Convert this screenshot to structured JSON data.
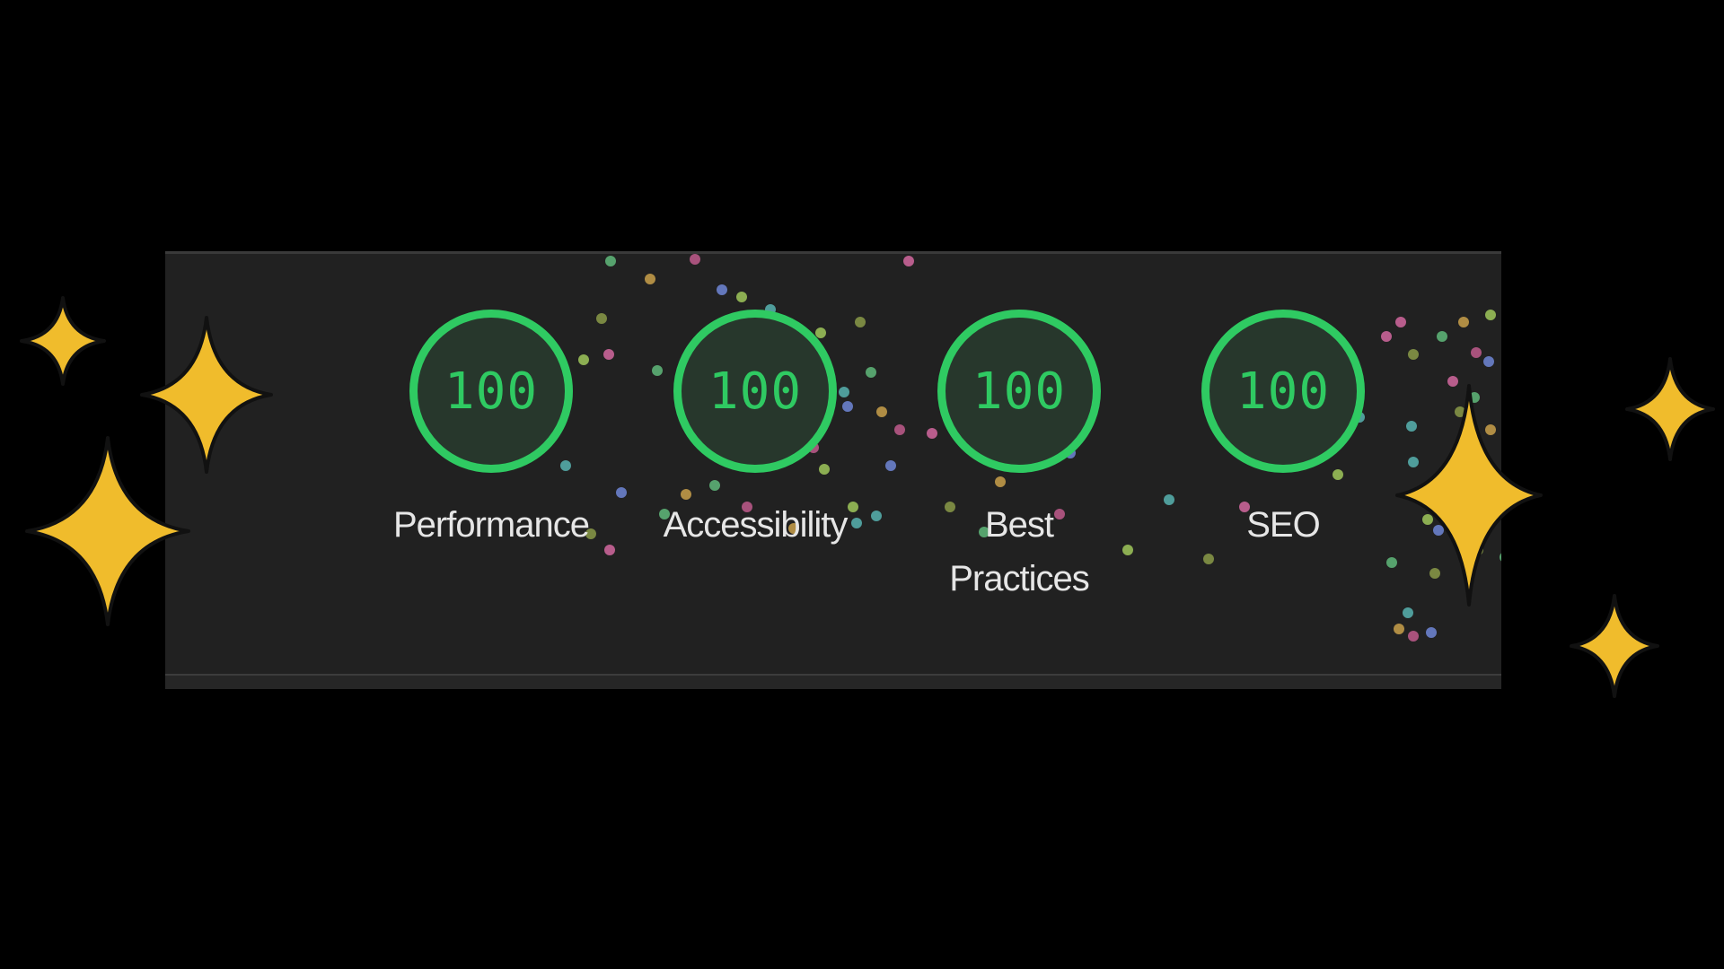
{
  "report": {
    "categories": [
      {
        "label": "Performance",
        "score": "100"
      },
      {
        "label": "Accessibility",
        "score": "100"
      },
      {
        "label": "Best\nPractices",
        "score": "100"
      },
      {
        "label": "SEO",
        "score": "100"
      }
    ]
  },
  "colors": {
    "page_background": "#000000",
    "panel_background": "#212121",
    "score_pass": "#2fca62",
    "gauge_fill": "#27372c",
    "label_text": "#e6e6e6",
    "sparkle_fill": "#f0bc2c",
    "sparkle_outline": "#111111"
  },
  "decorations": {
    "sparkle_icon": "four-point-star-icon",
    "confetti_icon": "confetti-dot-icon",
    "confetti_colors": [
      "#5fb87a",
      "#c9a04a",
      "#c05a8c",
      "#6f86d6",
      "#9fc75a",
      "#57b3b0",
      "#d2679f",
      "#8a9a48"
    ]
  }
}
